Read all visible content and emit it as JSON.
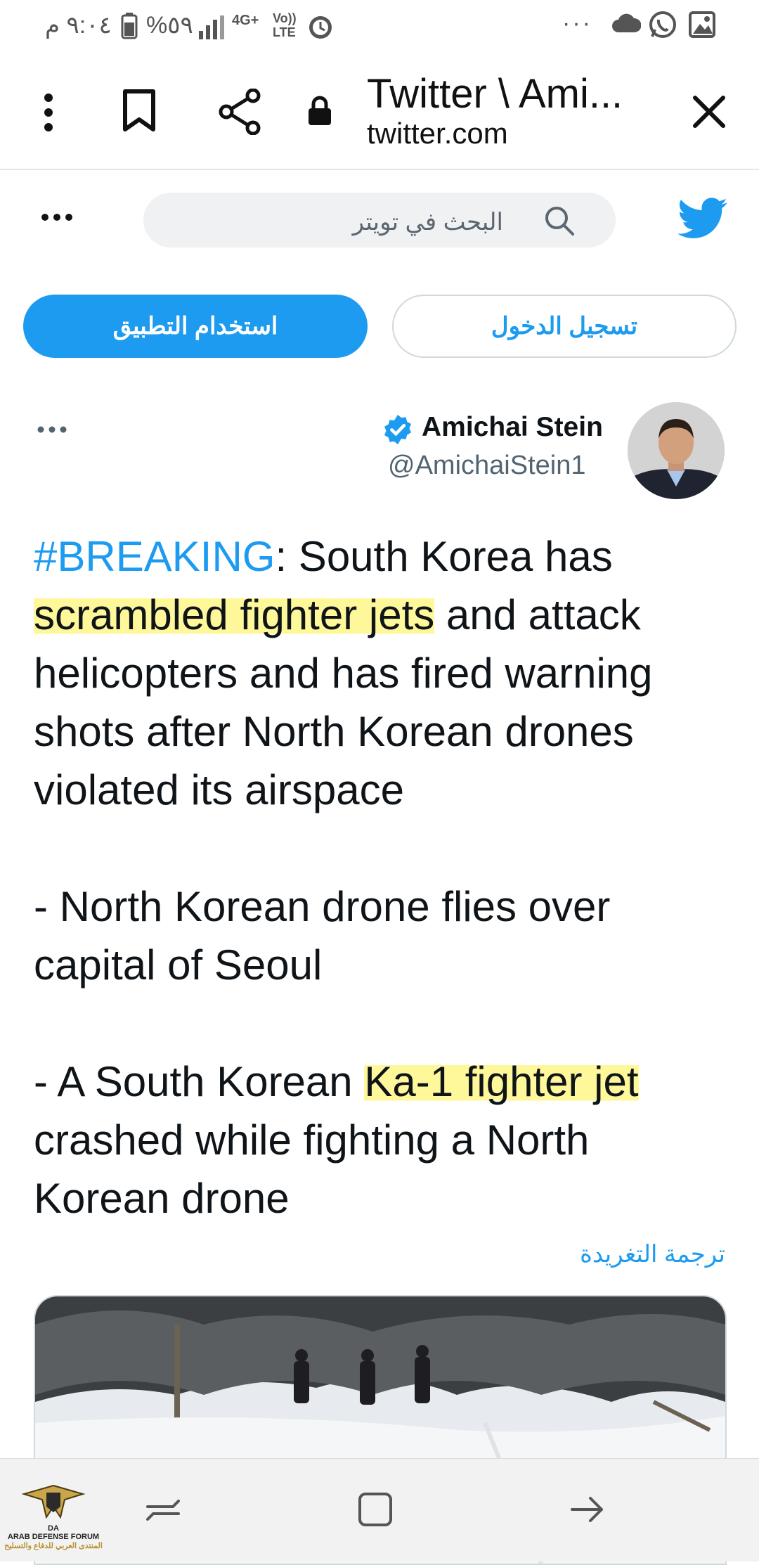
{
  "status_bar": {
    "time": "٩:٠٤ م",
    "battery": "%٥٩",
    "network": "4G+",
    "volte": "Vo)) LTE"
  },
  "browser": {
    "tab_title": "Twitter \\ Ami...",
    "domain": "twitter.com"
  },
  "twitter": {
    "search_placeholder": "البحث في تويتر",
    "use_app_button": "استخدام التطبيق",
    "login_button": "تسجيل الدخول"
  },
  "tweet": {
    "author_name": "Amichai Stein",
    "author_handle": "@AmichaiStein1",
    "hashtag": "#BREAKING",
    "line1_rest": ": South Korea has",
    "line2_highlight": "scrambled fighter jets",
    "line2_rest": " and attack helicopters and has fired warning shots after North Korean drones violated its airspace",
    "para2": "- North Korean drone flies over capital of Seoul",
    "para3_prefix": "- A South Korean ",
    "para3_highlight": "Ka-1 fighter jet",
    "para3_rest": " crashed while fighting a North Korean drone",
    "translate_link": "ترجمة التغريدة"
  },
  "watermark": {
    "line1": "DA",
    "line2": "ARAB DEFENSE FORUM",
    "line3": "المنتدى العربي للدفاع والتسليح"
  },
  "colors": {
    "accent": "#1d9bf0",
    "highlight": "#fff682"
  }
}
